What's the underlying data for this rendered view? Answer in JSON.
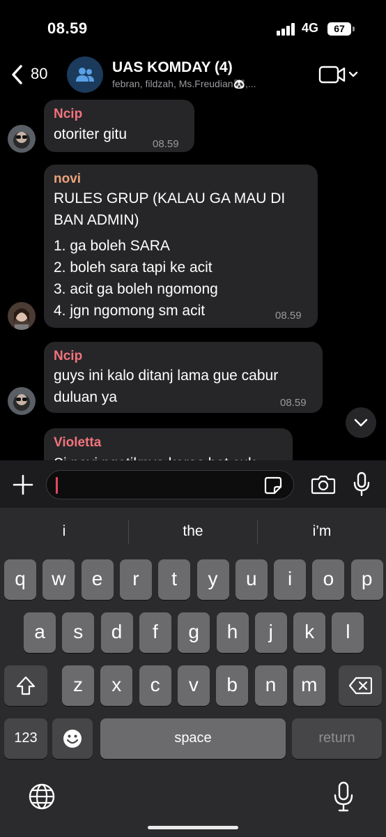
{
  "status": {
    "time": "08.59",
    "network": "4G",
    "battery": "67"
  },
  "header": {
    "back_count": "80",
    "title": "UAS KOMDAY (4)",
    "members": "febran, fildzah, Ms.Freudian🐼,..."
  },
  "messages": [
    {
      "sender": "Ncip",
      "sender_color": "#f2737d",
      "lines": [
        "otoriter gitu"
      ],
      "time": "08.59"
    },
    {
      "sender": "novi",
      "sender_color": "#e9a27c",
      "lines": [
        "RULES GRUP (KALAU GA MAU DI",
        "BAN ADMIN)",
        "1. ga boleh SARA",
        "2. boleh sara tapi ke acit",
        "3. acit ga boleh ngomong",
        "4. jgn ngomong sm acit"
      ],
      "time": "08.59"
    },
    {
      "sender": "Ncip",
      "sender_color": "#f2737d",
      "lines": [
        "guys ini kalo ditanj lama gue cabur",
        "duluan ya"
      ],
      "time": "08.59"
    },
    {
      "sender": "Violetta",
      "sender_color": "#f2737d",
      "lines": [
        "Si novi ngetiknya keras bat cuk"
      ],
      "time": ""
    }
  ],
  "input": {
    "placeholder": ""
  },
  "keyboard": {
    "suggestions": [
      "i",
      "the",
      "i’m"
    ],
    "row1": [
      "q",
      "w",
      "e",
      "r",
      "t",
      "y",
      "u",
      "i",
      "o",
      "p"
    ],
    "row2": [
      "a",
      "s",
      "d",
      "f",
      "g",
      "h",
      "j",
      "k",
      "l"
    ],
    "row3": [
      "z",
      "x",
      "c",
      "v",
      "b",
      "n",
      "m"
    ],
    "numbers_label": "123",
    "space_label": "space",
    "return_label": "return"
  },
  "colors": {
    "accent_cursor": "#e2475b",
    "bubble": "#262628",
    "keyboard_bg": "#2b2b2d"
  }
}
